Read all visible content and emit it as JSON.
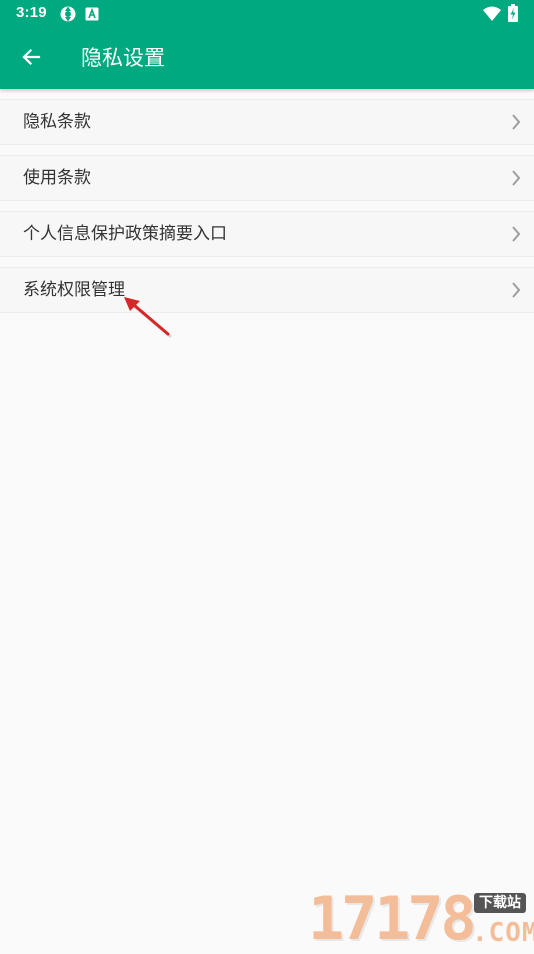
{
  "status_bar": {
    "time": "3:19",
    "icons_left": [
      "sync-icon",
      "app-notification-icon"
    ],
    "icons_right": [
      "wifi-icon",
      "battery-charging-icon"
    ]
  },
  "app_bar": {
    "title": "隐私设置",
    "back_icon": "arrow-left-icon",
    "background_color": "#00a97f"
  },
  "menu": {
    "items": [
      {
        "label": "隐私条款",
        "icon": "chevron-right-icon"
      },
      {
        "label": "使用条款",
        "icon": "chevron-right-icon"
      },
      {
        "label": "个人信息保护政策摘要入口",
        "icon": "chevron-right-icon"
      },
      {
        "label": "系统权限管理",
        "icon": "chevron-right-icon"
      }
    ]
  },
  "annotation": {
    "type": "red-arrow",
    "color": "#d62828"
  },
  "watermark": {
    "digits": "17178",
    "badge": "下载站",
    "suffix": ".COM"
  }
}
